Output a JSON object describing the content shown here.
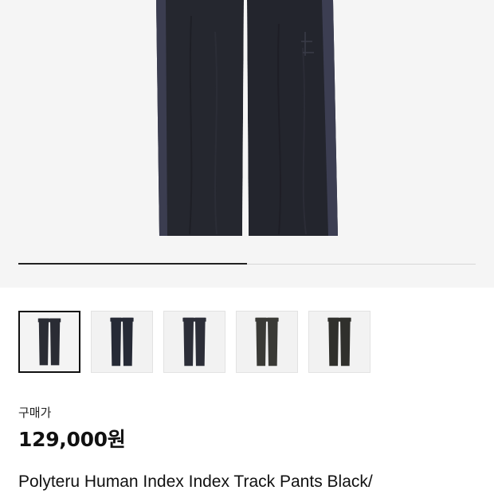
{
  "product": {
    "image_alt": "track pants product image",
    "gallery_progress": 0.5,
    "thumbnails": [
      {
        "name": "thumbnail-1",
        "selected": true,
        "color": "#2a2c34"
      },
      {
        "name": "thumbnail-2",
        "selected": false,
        "color": "#262a36"
      },
      {
        "name": "thumbnail-3",
        "selected": false,
        "color": "#2c2e38"
      },
      {
        "name": "thumbnail-4",
        "selected": false,
        "color": "#3a3a36"
      },
      {
        "name": "thumbnail-5",
        "selected": false,
        "color": "#30302c"
      }
    ],
    "price_label": "구매가",
    "price": "129,000원",
    "title": "Polyteru Human Index Index Track Pants Black/"
  },
  "colors": {
    "hero_bg": "#f5f5f5",
    "pants_main": "#24262e",
    "pants_stripe": "#3d3f52",
    "progress_fill": "#222222"
  }
}
